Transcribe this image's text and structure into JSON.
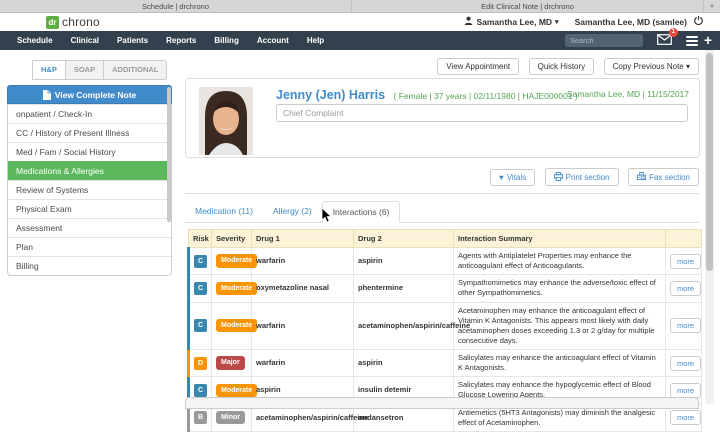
{
  "browser": {
    "tabs": [
      {
        "title": "Schedule | drchrono"
      },
      {
        "title": "Edit Clinical Note | drchrono"
      }
    ],
    "new_tab_label": "+"
  },
  "header": {
    "logo_dr": "dr",
    "logo_chrono": "chrono",
    "user_dropdown": "Samantha Lee, MD",
    "user_dropdown_caret": "▾",
    "user_account": "Samantha Lee, MD (samlee)"
  },
  "nav": {
    "items": [
      {
        "label": "Schedule"
      },
      {
        "label": "Clinical"
      },
      {
        "label": "Patients"
      },
      {
        "label": "Reports"
      },
      {
        "label": "Billing"
      },
      {
        "label": "Account"
      },
      {
        "label": "Help"
      }
    ],
    "search_placeholder": "Search",
    "message_badge": "1",
    "plus_label": "+"
  },
  "sidebar": {
    "tabs": [
      {
        "label": "H&P",
        "active": true
      },
      {
        "label": "SOAP"
      },
      {
        "label": "ADDITIONAL"
      }
    ],
    "view_note_button": "View Complete Note",
    "items": [
      {
        "label": "onpatient / Check-In"
      },
      {
        "label": "CC / History of Present Illness"
      },
      {
        "label": "Med / Fam / Social History"
      },
      {
        "label": "Medications & Allergies",
        "active": true
      },
      {
        "label": "Review of Systems"
      },
      {
        "label": "Physical Exam"
      },
      {
        "label": "Assessment"
      },
      {
        "label": "Plan"
      },
      {
        "label": "Billing"
      }
    ]
  },
  "toolbar": {
    "view_appointment": "View Appointment",
    "quick_history": "Quick History",
    "copy_previous_note": "Copy Previous Note ▾"
  },
  "patient": {
    "name": "Jenny (Jen) Harris",
    "meta": "( Female | 37 years | 02/11/1980 | HAJE000001 )",
    "provider_date": "Samantha Lee, MD | 11/15/2017",
    "chief_complaint_placeholder": "Chief Complaint"
  },
  "section_actions": {
    "vitals": "Vitals",
    "vitals_glyph": "♥",
    "print": "Print section",
    "fax": "Fax section"
  },
  "med_tabs": [
    {
      "label": "Medication (11)"
    },
    {
      "label": "Allergy (2)"
    },
    {
      "label": "Interactions (6)",
      "active": true
    }
  ],
  "interactions_table": {
    "columns": [
      {
        "label": "Risk"
      },
      {
        "label": "Severity"
      },
      {
        "label": "Drug 1"
      },
      {
        "label": "Drug 2"
      },
      {
        "label": "Interaction Summary"
      },
      {
        "label": ""
      }
    ],
    "more_label": "more",
    "rows": [
      {
        "risk": "C",
        "severity": "Moderate",
        "drug1": "warfarin",
        "drug2": "aspirin",
        "summary": "Agents with Antiplatelet Properties may enhance the anticoagulant effect of Anticoagulants."
      },
      {
        "risk": "C",
        "severity": "Moderate",
        "drug1": "oxymetazoline nasal",
        "drug2": "phentermine",
        "summary": "Sympathomimetics may enhance the adverse/toxic effect of other Sympathomimetics."
      },
      {
        "risk": "C",
        "severity": "Moderate",
        "drug1": "warfarin",
        "drug2": "acetaminophen/aspirin/caffeine",
        "summary": "Acetaminophen may enhance the anticoagulant effect of Vitamin K Antagonists. This appears most likely with daily acetaminophen doses exceeding 1.3 or 2 g/day for multiple consecutive days."
      },
      {
        "risk": "D",
        "severity": "Major",
        "drug1": "warfarin",
        "drug2": "aspirin",
        "summary": "Salicylates may enhance the anticoagulant effect of Vitamin K Antagonists."
      },
      {
        "risk": "C",
        "severity": "Moderate",
        "drug1": "aspirin",
        "drug2": "insulin detemir",
        "summary": "Salicylates may enhance the hypoglycemic effect of Blood Glucose Lowering Agents."
      },
      {
        "risk": "B",
        "severity": "Minor",
        "drug1": "acetaminophen/aspirin/caffeine",
        "drug2": "ondansetron",
        "summary": "Antiemetics (5HT3 Antagonists) may diminish the analgesic effect of Acetaminophen."
      }
    ]
  },
  "colors": {
    "risk_C": "#3a87ad",
    "risk_D": "#f89406",
    "risk_B": "#999999",
    "severity_moderate": "#f89406",
    "severity_major": "#b94a48",
    "severity_minor": "#999999",
    "brand_green": "#5cb85c",
    "link_blue": "#428bca",
    "nav_dark": "#33404d",
    "table_header_bg": "#fbf2d7",
    "badge_red": "#e74c3c"
  }
}
